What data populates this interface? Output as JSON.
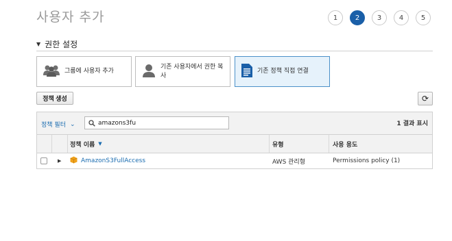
{
  "header": {
    "title": "사용자 추가"
  },
  "steps": [
    "1",
    "2",
    "3",
    "4",
    "5"
  ],
  "active_step": "2",
  "section": {
    "title": "권한 설정"
  },
  "options": [
    {
      "label": "그룹에 사용자 추가",
      "icon": "group-icon"
    },
    {
      "label": "기존 사용자에서 권한 복사",
      "icon": "user-icon"
    },
    {
      "label": "기존 정책 직접 연결",
      "icon": "document-icon"
    }
  ],
  "toolbar": {
    "create_policy_label": "정책 생성",
    "refresh_icon": "refresh-icon"
  },
  "filter": {
    "label": "정책 필터",
    "search_value": "amazons3fu",
    "result_count": "1 결과 표시"
  },
  "table": {
    "columns": [
      "정책 이름",
      "유형",
      "사용 용도"
    ],
    "rows": [
      {
        "name": "AmazonS3FullAccess",
        "type": "AWS 관리형",
        "usage": "Permissions policy (1)"
      }
    ]
  },
  "colors": {
    "accent": "#1a5fa8",
    "link": "#1a6cb0",
    "selected_card": "#e6f2fb"
  }
}
